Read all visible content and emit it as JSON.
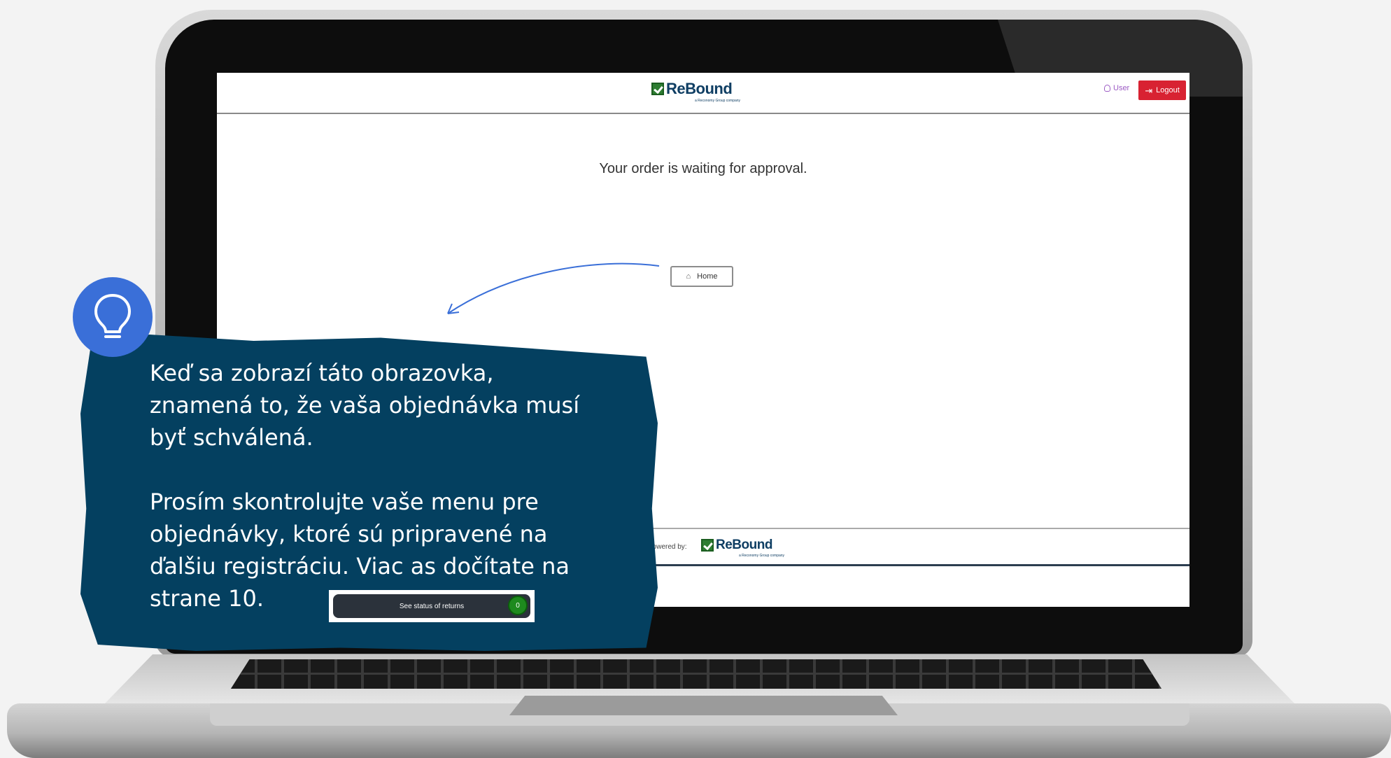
{
  "header": {
    "brand_name": "ReBound",
    "brand_tagline": "a Reconomy Group company",
    "user_label": "User",
    "logout_label": "Logout"
  },
  "main": {
    "status_message": "Your order is waiting for approval.",
    "home_button_label": "Home"
  },
  "footer": {
    "powered_by_label": "Powered by:",
    "brand_name": "ReBound",
    "brand_tagline": "a Reconomy Group company"
  },
  "annotation": {
    "tip_text": "Keď sa zobrazí táto obrazovka,\nznamená to, že vaša objednávka musí\nbyť schválená.\n\nProsím skontrolujte vaše menu pre\nobjednávky, ktoré sú pripravené na\nďalšiu registráciu. Viac as dočítate na\nstrane 10.",
    "returns_button_label": "See status of returns",
    "returns_count": "0",
    "icon": "lightbulb-icon"
  },
  "colors": {
    "tip_panel": "#044060",
    "bulb_circle": "#3a6fd8",
    "logout": "#d82232",
    "brand_text": "#0f3e63",
    "brand_check": "#2e7d32",
    "returns_badge": "#1e8a1e"
  }
}
